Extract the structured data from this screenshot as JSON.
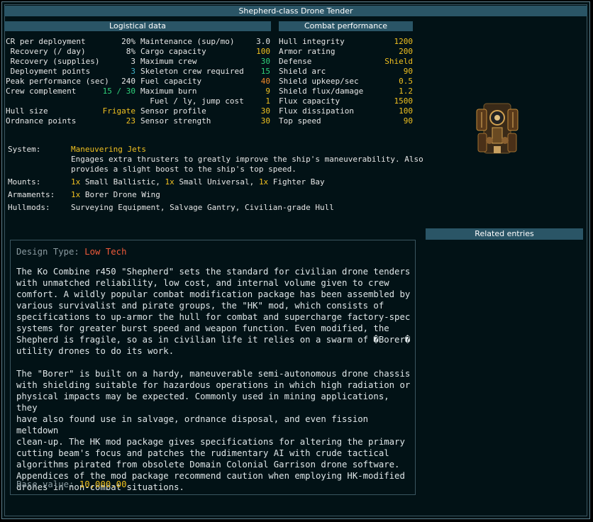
{
  "title": "Shepherd-class Drone Tender",
  "logistical": {
    "header": "Logistical data",
    "col1": [
      {
        "label": "CR per deployment",
        "value": "20%",
        "color": "#e6e6e6"
      },
      {
        "label": " Recovery (/ day)",
        "value": "8%",
        "color": "#e6e6e6"
      },
      {
        "label": " Recovery (supplies)",
        "value": "3",
        "color": "#e6e6e6"
      },
      {
        "label": " Deployment points",
        "value": "3",
        "color": "#3fb2c8"
      },
      {
        "label": "Peak performance (sec)",
        "value": "240",
        "color": "#e6e6e6"
      },
      {
        "label": "Crew complement",
        "value": "15 / 30",
        "color": "#2fd17a"
      },
      {
        "label": "",
        "value": "",
        "color": "#e6e6e6"
      },
      {
        "label": "Hull size",
        "value": "Frigate",
        "color": "#f0c020"
      },
      {
        "label": "Ordnance points",
        "value": "23",
        "color": "#f0c020"
      }
    ],
    "col2": [
      {
        "label": "Maintenance (sup/mo)",
        "value": "3.0",
        "color": "#e6e6e6"
      },
      {
        "label": "Cargo capacity",
        "value": "100",
        "color": "#f0c020"
      },
      {
        "label": "Maximum crew",
        "value": "30",
        "color": "#2fd17a"
      },
      {
        "label": "Skeleton crew required",
        "value": "15",
        "color": "#2fd17a"
      },
      {
        "label": "Fuel capacity",
        "value": "40",
        "color": "#f0892a"
      },
      {
        "label": "Maximum burn",
        "value": "9",
        "color": "#f0c020"
      },
      {
        "label": "  Fuel / ly, jump cost",
        "value": "1",
        "color": "#f0c020"
      },
      {
        "label": "Sensor profile",
        "value": "30",
        "color": "#f0c020"
      },
      {
        "label": "Sensor strength",
        "value": "30",
        "color": "#f0c020"
      }
    ]
  },
  "combat": {
    "header": "Combat performance",
    "rows": [
      {
        "label": "Hull integrity",
        "value": "1200",
        "color": "#f0c020"
      },
      {
        "label": "Armor rating",
        "value": "200",
        "color": "#f0c020"
      },
      {
        "label": "Defense",
        "value": "Shield",
        "color": "#f0c020"
      },
      {
        "label": "Shield arc",
        "value": "90",
        "color": "#f0c020"
      },
      {
        "label": "Shield upkeep/sec",
        "value": "0.5",
        "color": "#f0c020"
      },
      {
        "label": "Shield flux/damage",
        "value": "1.2",
        "color": "#f0c020"
      },
      {
        "label": "Flux capacity",
        "value": "1500",
        "color": "#f0c020"
      },
      {
        "label": "Flux dissipation",
        "value": "100",
        "color": "#f0c020"
      },
      {
        "label": "Top speed",
        "value": "90",
        "color": "#f0c020"
      }
    ]
  },
  "system": {
    "label": "System:",
    "name": "Maneuvering Jets",
    "desc1": "Engages extra thrusters to greatly improve the ship's maneuverability. Also",
    "desc2": "provides a slight boost to the ship's top speed."
  },
  "mounts": {
    "label": "Mounts:",
    "q1": "1x",
    "m1": " Small Ballistic, ",
    "q2": "1x",
    "m2": " Small Universal, ",
    "q3": "1x",
    "m3": " Fighter Bay"
  },
  "armaments": {
    "label": "Armaments:",
    "q": "1x",
    "text": " Borer Drone Wing"
  },
  "hullmods": {
    "label": "Hullmods:",
    "text": "Surveying Equipment, Salvage Gantry, Civilian-grade Hull"
  },
  "related": {
    "header": "Related entries"
  },
  "design": {
    "label": "Design Type: ",
    "value": "Low Tech"
  },
  "description": {
    "p1": "The Ko Combine r450 \"Shepherd\" sets the standard for civilian drone tenders\nwith unmatched reliability, low cost, and internal volume given to crew\ncomfort. A wildly popular combat modification package has been assembled by\nvarious survivalist and pirate groups, the \"HK\" mod, which consists of\nspecifications to up-armor the hull for combat and supercharge factory-spec\nsystems for greater burst speed and weapon function. Even modified, the\nShepherd is fragile, so as in civilian life it relies on a swarm of �Borer�\nutility drones to do its work.",
    "p2": "The \"Borer\" is built on a hardy, maneuverable semi-autonomous drone chassis\nwith shielding suitable for hazardous operations in which high radiation or\nphysical impacts may be expected. Commonly used in mining applications, they\nhave also found use in salvage, ordnance disposal, and even fission meltdown\nclean-up. The HK mod package gives specifications for altering the primary\ncutting beam's focus and patches the rudimentary AI with crude tactical\nalgorithms pirated from obsolete Domain Colonial Garrison drone software.\nAppendices of the mod package recommend caution when employing HK-modified\ndrones in non-combat situations."
  },
  "base_value": {
    "label": "Base value: ",
    "value": "10,000.00"
  },
  "colors": {
    "highlight": "#f0c020",
    "green": "#2fd17a",
    "cyan": "#3fb2c8",
    "orange": "#f0892a",
    "red": "#f05a3a",
    "header_bg": "#2a5566"
  },
  "icons": {
    "ship": "shepherd-ship-sprite"
  }
}
